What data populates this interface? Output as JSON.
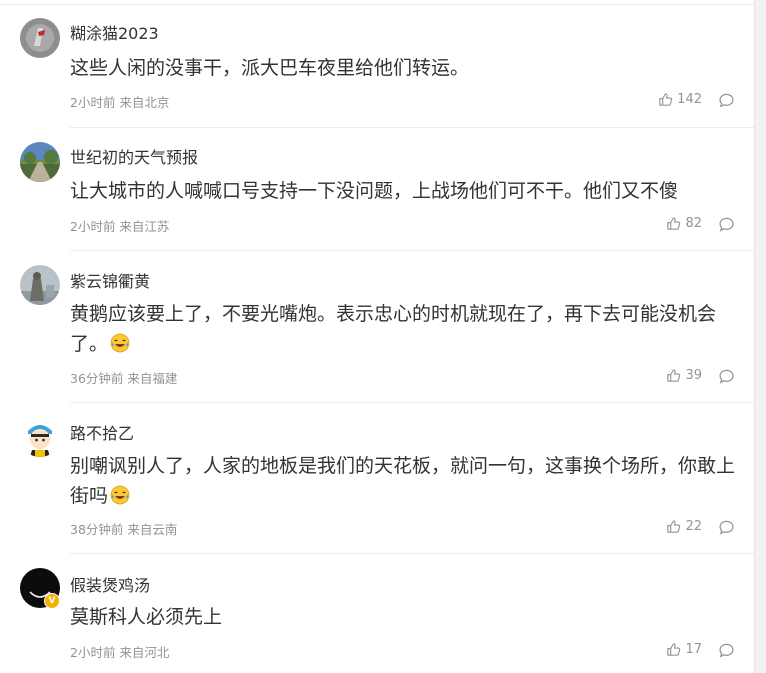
{
  "comments": [
    {
      "username": "糊涂猫2023",
      "text": "这些人闲的没事干，派大巴车夜里给他们转运。",
      "meta": "2小时前 来自北京",
      "likes": "142"
    },
    {
      "username": "世纪初的天气预报",
      "text": "让大城市的人喊喊口号支持一下没问题，上战场他们可不干。他们又不傻",
      "meta": "2小时前 来自江苏",
      "likes": "82"
    },
    {
      "username": "紫云锦衢黄",
      "text": "黄鹅应该要上了，不要光嘴炮。表示忠心的时机就现在了，再下去可能没机会了。",
      "meta": "36分钟前 来自福建",
      "likes": "39",
      "emoji": "laughing-tears-emoji"
    },
    {
      "username": "路不拾乙",
      "text": "别嘲讽别人了，人家的地板是我们的天花板，就问一句，这事换个场所，你敢上街吗",
      "meta": "38分钟前 来自云南",
      "likes": "22",
      "emoji": "laughing-tears-emoji"
    },
    {
      "username": "假装煲鸡汤",
      "text": "莫斯科人必须先上",
      "meta": "2小时前 来自河北",
      "likes": "17",
      "verified": true
    }
  ],
  "colors": {
    "text": "#333333",
    "meta": "#939393",
    "badge": "#f5b100"
  },
  "icons": {
    "like": "thumbs-up-icon",
    "reply": "comment-bubble-icon"
  }
}
